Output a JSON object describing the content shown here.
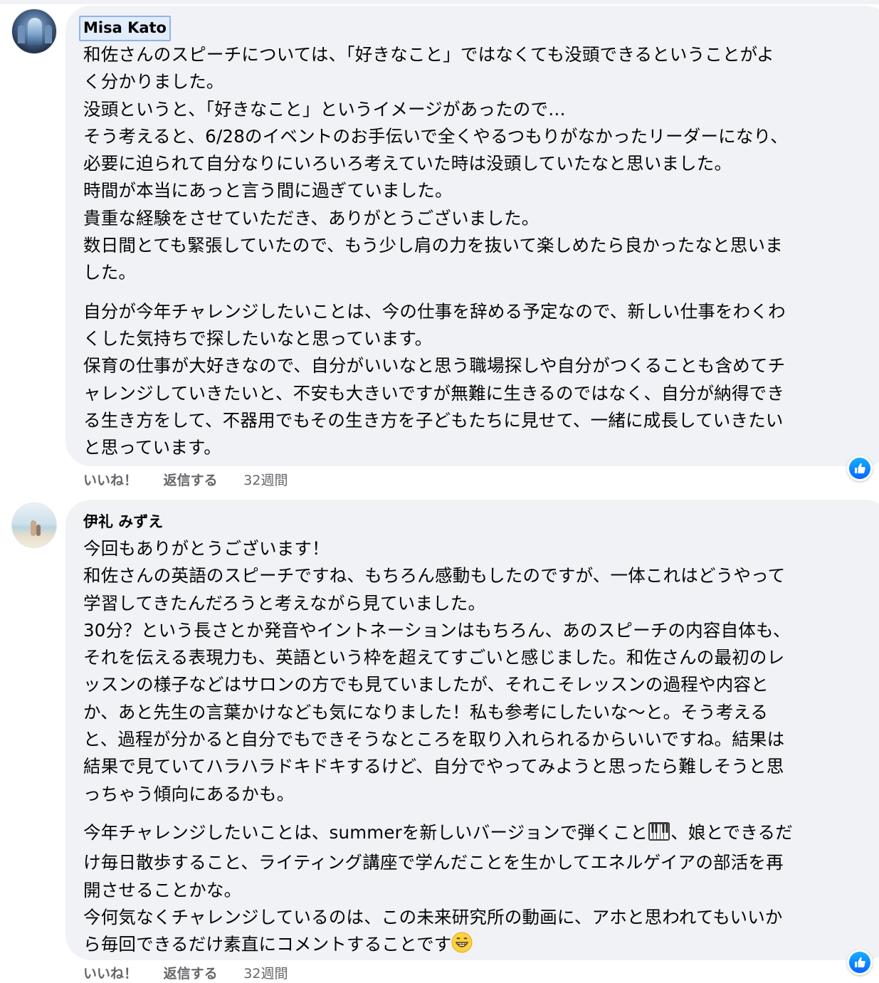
{
  "comments": [
    {
      "author": "Misa Kato",
      "paragraphs": [
        "和佐さんのスピーチについては、「好きなこと」ではなくても没頭できるということがよ\nく分かりました。\n没頭というと、「好きなこと」というイメージがあったので…\nそう考えると、6/28のイベントのお手伝いで全くやるつもりがなかったリーダーになり、\n必要に迫られて自分なりにいろいろ考えていた時は没頭していたなと思いました。\n時間が本当にあっと言う間に過ぎていました。\n貴重な経験をさせていただき、ありがとうございました。\n数日間とても緊張していたので、もう少し肩の力を抜いて楽しめたら良かったなと思いま\nした。",
        "自分が今年チャレンジしたいことは、今の仕事を辞める予定なので、新しい仕事をわくわ\nくした気持ちで探したいなと思っています。\n保育の仕事が大好きなので、自分がいいなと思う職場探しや自分がつくることも含めてチ\nャレンジしていきたいと、不安も大きいですが無難に生きるのではなく、自分が納得でき\nる生き方をして、不器用でもその生き方を子どもたちに見せて、一緒に成長していきたい\nと思っています。"
      ],
      "actions": {
        "like": "いいね！",
        "reply": "返信する",
        "time": "32週間"
      },
      "reaction_icon": "like-icon"
    },
    {
      "author": "伊礼 みずえ",
      "paragraphs": [
        "今回もありがとうございます！\n和佐さんの英語のスピーチですね、もちろん感動もしたのですが、一体これはどうやって\n学習してきたんだろうと考えながら見ていました。\n30分？という長さとか発音やイントネーションはもちろん、あのスピーチの内容自体も、\nそれを伝える表現力も、英語という枠を超えてすごいと感じました。和佐さんの最初のレ\nッスンの様子などはサロンの方でも見ていましたが、それこそレッスンの過程や内容と\nか、あと先生の言葉かけなども気になりました！私も参考にしたいな〜と。そう考える\nと、過程が分かると自分でもできそうなところを取り入れられるからいいですね。結果は\n結果で見ていてハラハラドキドキするけど、自分でやってみようと思ったら難しそうと思\nっちゃう傾向にあるかも。"
      ],
      "paragraph2_parts": {
        "before_piano": "今年チャレンジしたいことは、summerを新しいバージョンで弾くこと",
        "after_piano": "、娘とできるだ\nけ毎日散歩すること、ライティング講座で学んだことを生かしてエネルゲイアの部活を再\n開させることかな。\n今何気なくチャレンジしているのは、この未来研究所の動画に、アホと思われてもいいか\nら毎回できるだけ素直にコメントすることです",
        "piano_icon": "piano-emoji-icon",
        "grin_icon": "grinning-emoji-icon"
      },
      "actions": {
        "like": "いいね！",
        "reply": "返信する",
        "time": "32週間"
      },
      "reaction_icon": "like-icon"
    }
  ],
  "colors": {
    "bubble": "#f0f2f5",
    "action_text": "#65676b",
    "like_blue": "#0866ff"
  }
}
